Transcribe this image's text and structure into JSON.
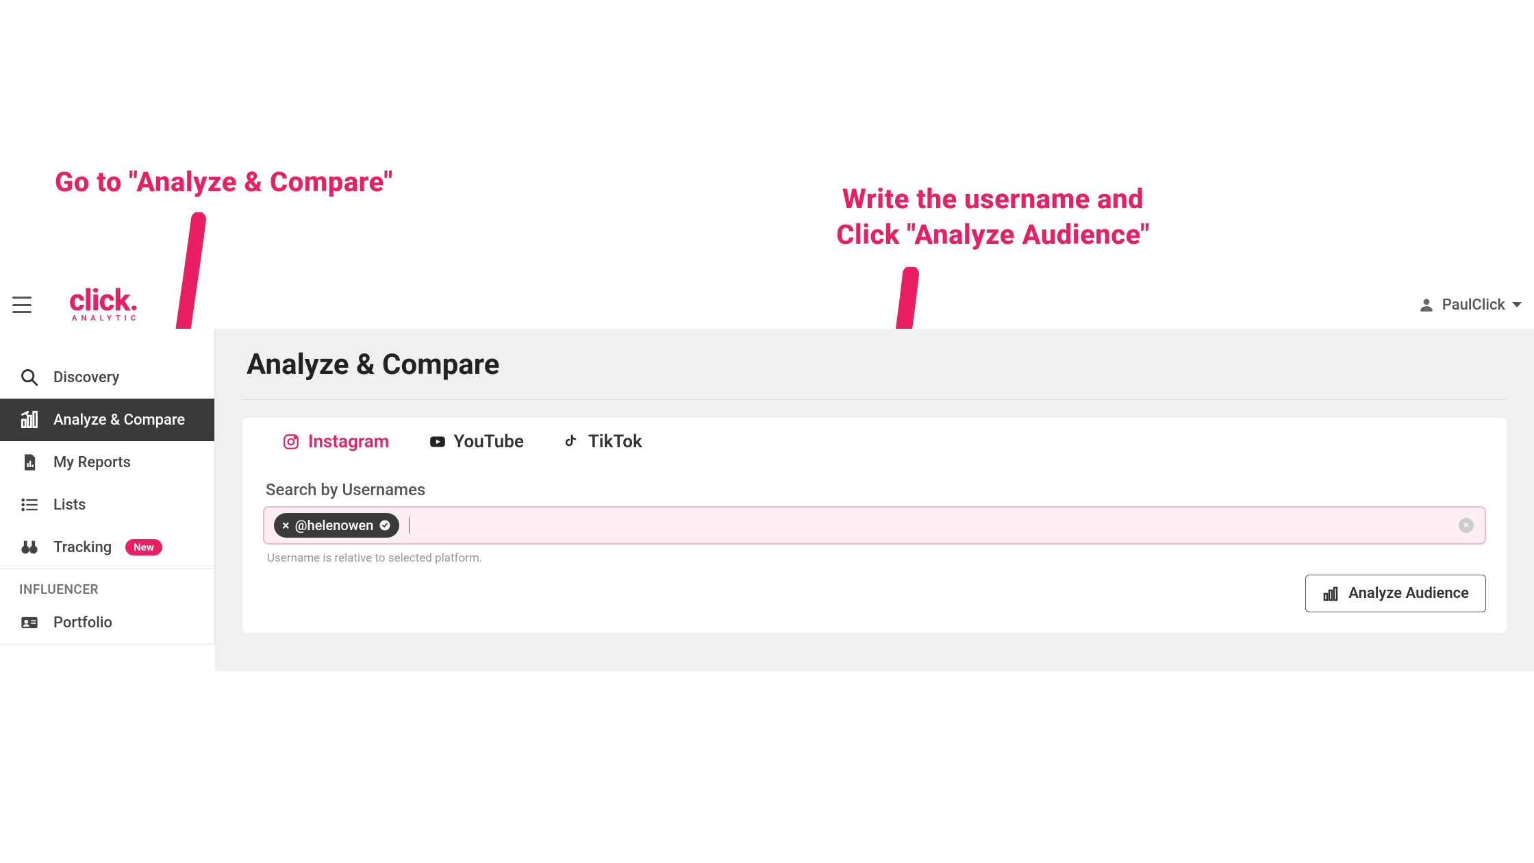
{
  "annotations": {
    "left": "Go to \"Analyze & Compare\"",
    "right_line1": "Write the username and",
    "right_line2": "Click \"Analyze Audience\""
  },
  "logo": {
    "main": "click.",
    "sub": "ANALYTIC"
  },
  "user": {
    "name": "PaulClick"
  },
  "sidebar": {
    "items": [
      {
        "label": "Discovery"
      },
      {
        "label": "Analyze & Compare"
      },
      {
        "label": "My Reports"
      },
      {
        "label": "Lists"
      },
      {
        "label": "Tracking",
        "badge": "New"
      }
    ],
    "section": "INFLUENCER",
    "portfolio": "Portfolio"
  },
  "page": {
    "title": "Analyze & Compare"
  },
  "tabs": {
    "instagram": "Instagram",
    "youtube": "YouTube",
    "tiktok": "TikTok"
  },
  "search": {
    "label": "Search by Usernames",
    "chip": "@helenowen",
    "hint": "Username is relative to selected platform."
  },
  "actions": {
    "analyze": "Analyze Audience"
  }
}
